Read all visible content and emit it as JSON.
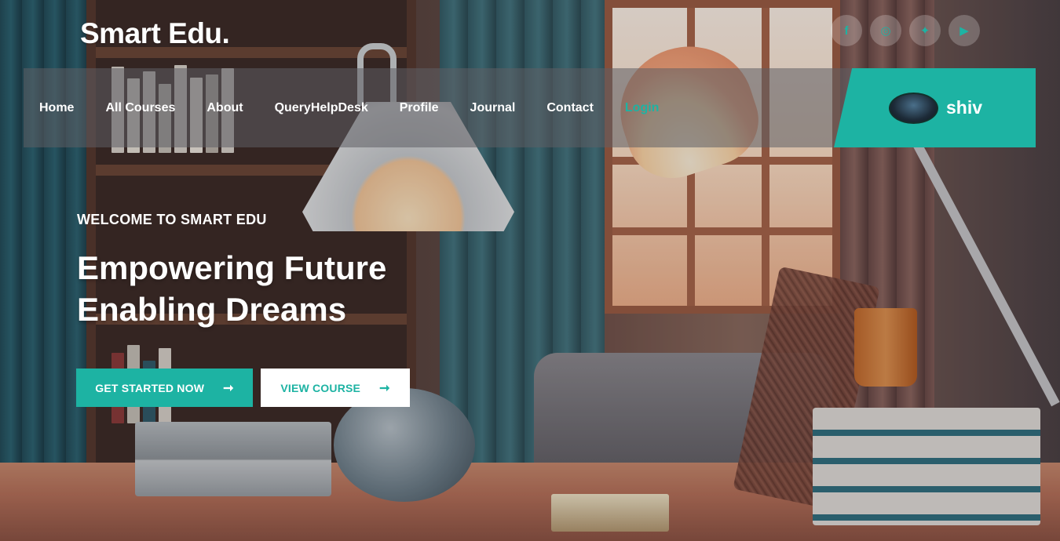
{
  "brand": {
    "name": "Smart Edu."
  },
  "social": [
    {
      "name": "facebook-icon",
      "glyph": "f"
    },
    {
      "name": "instagram-icon",
      "glyph": "◎"
    },
    {
      "name": "twitter-icon",
      "glyph": "✦"
    },
    {
      "name": "youtube-icon",
      "glyph": "▶"
    }
  ],
  "nav": {
    "items": [
      {
        "label": "Home"
      },
      {
        "label": "All Courses"
      },
      {
        "label": "About"
      },
      {
        "label": "QueryHelpDesk"
      },
      {
        "label": "Profile"
      },
      {
        "label": "Journal"
      },
      {
        "label": "Contact"
      },
      {
        "label": "Login"
      }
    ]
  },
  "user": {
    "name": "shiv"
  },
  "hero": {
    "subtitle": "WELCOME TO SMART EDU",
    "title_line1": "Empowering Future",
    "title_line2": "Enabling Dreams",
    "primary_button": "GET STARTED NOW",
    "secondary_button": "VIEW COURSE",
    "arrow": "➞"
  },
  "colors": {
    "accent": "#1db3a3",
    "text": "#ffffff"
  }
}
